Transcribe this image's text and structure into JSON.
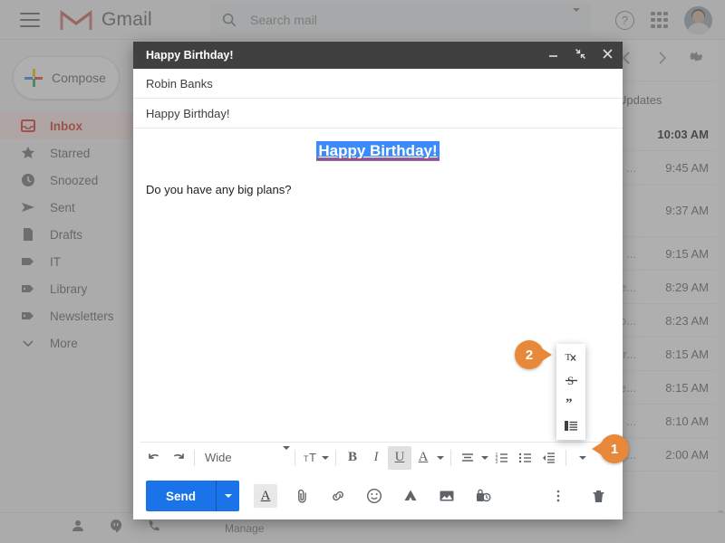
{
  "topbar": {
    "menu_icon": "hamburger-icon",
    "brand": "Gmail",
    "search_placeholder": "Search mail",
    "search_icon": "search-icon",
    "search_options_icon": "chevron-down-icon",
    "help_icon": "help-icon",
    "help_glyph": "?",
    "apps_icon": "apps-grid-icon",
    "avatar_icon": "user-avatar"
  },
  "sidebar": {
    "compose_label": "Compose",
    "items": [
      {
        "label": "Inbox",
        "icon": "inbox-icon",
        "active": true
      },
      {
        "label": "Starred",
        "icon": "star-icon",
        "active": false
      },
      {
        "label": "Snoozed",
        "icon": "clock-icon",
        "active": false
      },
      {
        "label": "Sent",
        "icon": "send-icon",
        "active": false
      },
      {
        "label": "Drafts",
        "icon": "document-icon",
        "active": false
      },
      {
        "label": "IT",
        "icon": "label-icon",
        "active": false
      },
      {
        "label": "Library",
        "icon": "label-icon",
        "active": false
      },
      {
        "label": "Newsletters",
        "icon": "label-icon",
        "active": false
      },
      {
        "label": "More",
        "icon": "chevron-down-icon",
        "active": false
      }
    ]
  },
  "list_toolbar": {
    "prev_icon": "chevron-left-icon",
    "next_icon": "chevron-right-icon",
    "settings_icon": "gear-icon"
  },
  "tabs": {
    "updates_label": "Updates"
  },
  "mail_rows": [
    {
      "snippet": "",
      "time": "10:03 AM",
      "unread": true
    },
    {
      "snippet": "...",
      "time": "9:45 AM",
      "unread": false
    },
    {
      "snippet": "",
      "time": "9:37 AM",
      "unread": false
    },
    {
      "snippet": "...",
      "time": "9:15 AM",
      "unread": false
    },
    {
      "snippet": "e...",
      "time": "8:29 AM",
      "unread": false
    },
    {
      "snippet": "o...",
      "time": "8:23 AM",
      "unread": false
    },
    {
      "snippet": "r...",
      "time": "8:15 AM",
      "unread": false
    },
    {
      "snippet": "e...",
      "time": "8:15 AM",
      "unread": false
    },
    {
      "snippet": "...",
      "time": "8:10 AM",
      "unread": false
    },
    {
      "snippet": "...",
      "time": "2:00 AM",
      "unread": false
    }
  ],
  "bottombar": {
    "contacts_icon": "person-icon",
    "hangouts_icon": "hangouts-icon",
    "phone_icon": "phone-icon",
    "manage_label": "Manage"
  },
  "compose": {
    "title": "Happy Birthday!",
    "minimize_icon": "minimize-icon",
    "exit_fullscreen_icon": "exit-fullscreen-icon",
    "close_icon": "close-icon",
    "recipient": "Robin Banks",
    "subject": "Happy Birthday!",
    "body_headline": "Happy Birthday!",
    "body_text": "Do you have any big plans?"
  },
  "format_toolbar": {
    "undo_icon": "undo-icon",
    "redo_icon": "redo-icon",
    "font_family_value": "Wide",
    "font_family_caret": "chevron-down-icon",
    "font_size_icon": "font-size-icon",
    "bold_label": "B",
    "italic_label": "I",
    "underline_label": "U",
    "text_color_label": "A",
    "align_icon": "align-icon",
    "numbered_list_icon": "numbered-list-icon",
    "bulleted_list_icon": "bulleted-list-icon",
    "indent_icon": "indent-icon",
    "more_options_icon": "chevron-down-icon"
  },
  "format_popup": {
    "items": [
      {
        "icon": "remove-formatting-icon",
        "label": "Remove formatting"
      },
      {
        "icon": "strikethrough-icon",
        "label": "Strikethrough"
      },
      {
        "icon": "quote-icon",
        "label": "Quote"
      },
      {
        "icon": "indent-less-icon",
        "label": "Indent less"
      }
    ]
  },
  "sendbar": {
    "send_label": "Send",
    "send_caret_icon": "chevron-down-icon",
    "formatting_icon": "text-format-icon",
    "formatting_label": "A",
    "attach_icon": "attachment-icon",
    "link_icon": "link-icon",
    "emoji_icon": "emoji-icon",
    "drive_icon": "google-drive-icon",
    "image_icon": "insert-image-icon",
    "confidential_icon": "confidential-mode-icon",
    "more_icon": "more-vertical-icon",
    "discard_icon": "trash-icon"
  },
  "callouts": [
    {
      "number": "2",
      "position": "points-right"
    },
    {
      "number": "1",
      "position": "points-left"
    }
  ],
  "colors": {
    "gmail_red": "#d93025",
    "accent_blue": "#1a73e8",
    "selection_blue": "#3b8bfc",
    "callout_orange": "#e8883a",
    "spellcheck_red": "#e53935",
    "compose_header": "#404040"
  }
}
